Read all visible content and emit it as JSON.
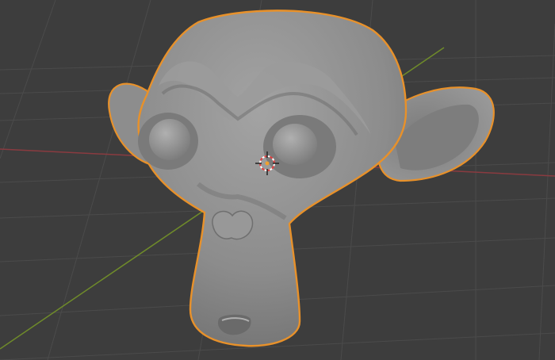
{
  "viewport": {
    "mode": "object",
    "background_color": "#3d3d3d",
    "grid_color": "#4a4a4a",
    "x_axis_color": "#8a3b40",
    "y_axis_color": "#6f8b2a"
  },
  "active_object": {
    "type": "monkey-mesh",
    "selected": true,
    "shading": "solid",
    "outline_color": "#e8912a",
    "surface_color": "#8f8f8f"
  },
  "cursor": {
    "icon": "3d-cursor-icon",
    "ring_colors": [
      "#e04040",
      "#ffffff"
    ]
  }
}
